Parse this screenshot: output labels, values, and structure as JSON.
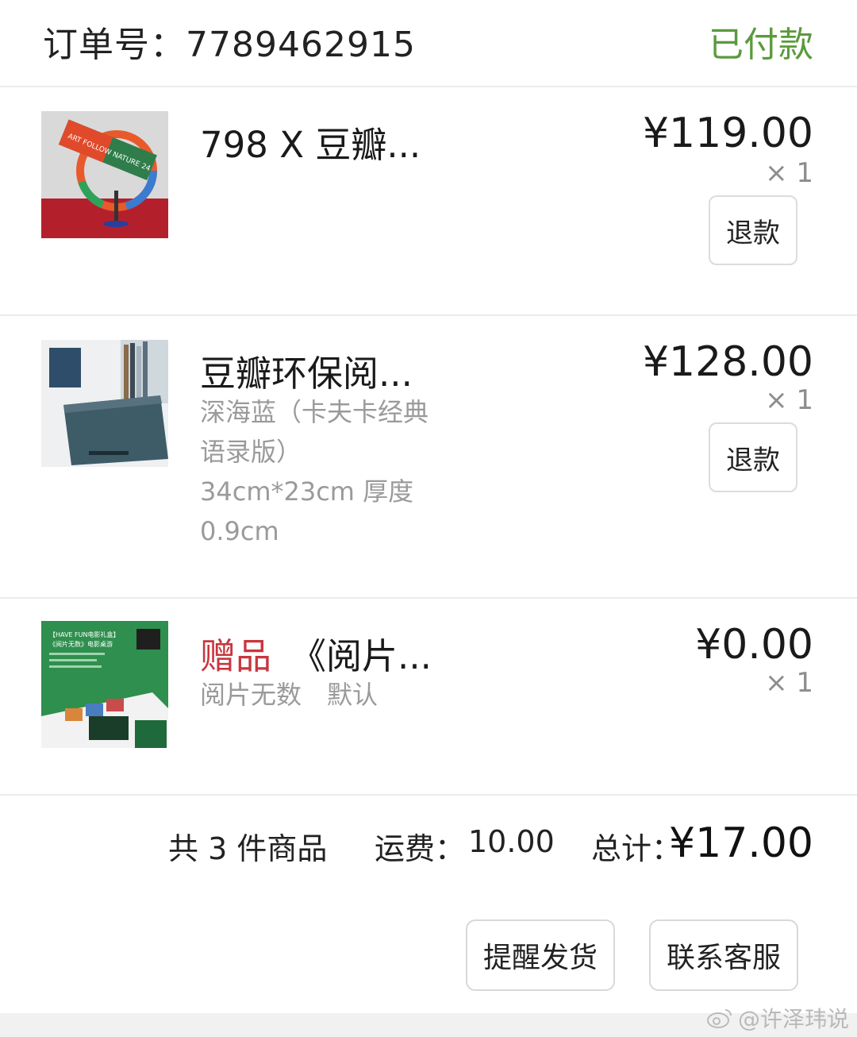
{
  "header": {
    "order_label": "订单号：7789462915",
    "status": "已付款"
  },
  "items": [
    {
      "title": "798 X 豆瓣...",
      "price": "¥119.00",
      "qty": "× 1",
      "refund_label": "退款"
    },
    {
      "title": "豆瓣环保阅...",
      "spec_lines": [
        "深海蓝（卡夫卡经典",
        "语录版）",
        "34cm*23cm 厚度",
        "0.9cm"
      ],
      "price": "¥128.00",
      "qty": "× 1",
      "refund_label": "退款"
    },
    {
      "gift_tag": "赠品",
      "title": "《阅片...",
      "spec_lines": [
        "阅片无数　默认"
      ],
      "price": "¥0.00",
      "qty": "× 1"
    }
  ],
  "thumbs": {
    "item1_text": "ART FOLLOW NATURE 24",
    "item3_line1": "【HAVE FUN电影礼盒】",
    "item3_line2": "《阅片无数》电影桌游"
  },
  "summary": {
    "count": "共 3 件商品",
    "shipping_label": "运费：",
    "shipping": "10.00",
    "total_label": "总计：",
    "total": "¥17.00"
  },
  "actions": {
    "remind": "提醒发货",
    "contact": "联系客服"
  },
  "watermark": "@许泽玮说"
}
